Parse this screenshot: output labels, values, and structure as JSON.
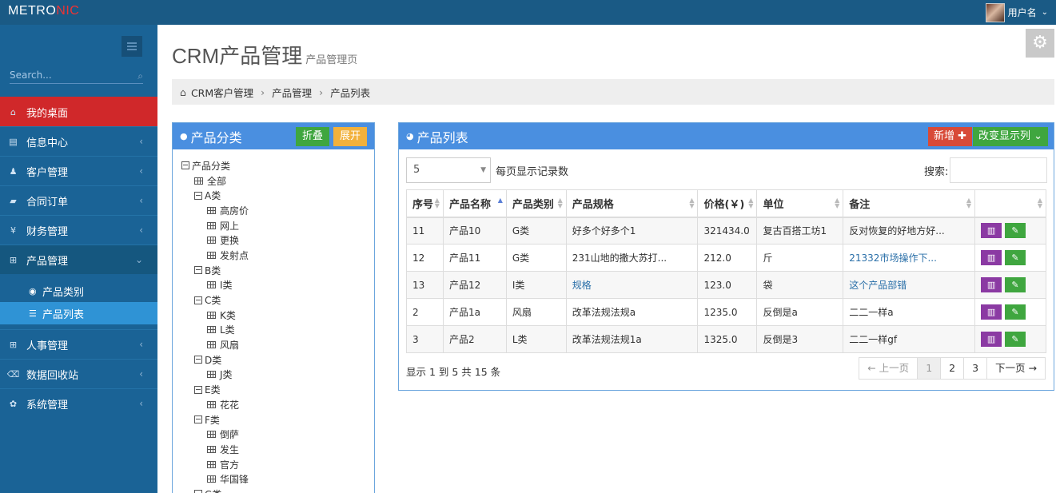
{
  "app": {
    "logo_left": "METRO",
    "logo_accent": "NIC",
    "user_name": "用户名"
  },
  "sidebar": {
    "search_placeholder": "Search...",
    "items": [
      {
        "label": "我的桌面",
        "icon": "home-icon"
      },
      {
        "label": "信息中心",
        "icon": "message-icon"
      },
      {
        "label": "客户管理",
        "icon": "user-icon"
      },
      {
        "label": "合同订单",
        "icon": "book-icon"
      },
      {
        "label": "财务管理",
        "icon": "yen-icon"
      },
      {
        "label": "产品管理",
        "icon": "table-icon"
      },
      {
        "label": "人事管理",
        "icon": "table-icon"
      },
      {
        "label": "数据回收站",
        "icon": "trash-icon"
      },
      {
        "label": "系统管理",
        "icon": "gear-icon"
      }
    ],
    "sub_items": [
      {
        "label": "产品类别"
      },
      {
        "label": "产品列表"
      }
    ]
  },
  "page": {
    "title": "CRM产品管理",
    "subtitle": "产品管理页"
  },
  "breadcrumb": [
    "CRM客户管理",
    "产品管理",
    "产品列表"
  ],
  "category_panel": {
    "title": "产品分类",
    "collapse_label": "折叠",
    "expand_label": "展开",
    "tree": [
      {
        "label": "产品分类",
        "level": 0,
        "type": "folder"
      },
      {
        "label": "全部",
        "level": 1,
        "type": "leaf"
      },
      {
        "label": "A类",
        "level": 1,
        "type": "folder"
      },
      {
        "label": "高房价",
        "level": 2,
        "type": "leaf"
      },
      {
        "label": "网上",
        "level": 2,
        "type": "leaf"
      },
      {
        "label": "更换",
        "level": 2,
        "type": "leaf"
      },
      {
        "label": "发射点",
        "level": 2,
        "type": "leaf"
      },
      {
        "label": "B类",
        "level": 1,
        "type": "folder"
      },
      {
        "label": "I类",
        "level": 2,
        "type": "leaf"
      },
      {
        "label": "C类",
        "level": 1,
        "type": "folder"
      },
      {
        "label": "K类",
        "level": 2,
        "type": "leaf"
      },
      {
        "label": "L类",
        "level": 2,
        "type": "leaf"
      },
      {
        "label": "风扇",
        "level": 2,
        "type": "leaf"
      },
      {
        "label": "D类",
        "level": 1,
        "type": "folder"
      },
      {
        "label": "J类",
        "level": 2,
        "type": "leaf"
      },
      {
        "label": "E类",
        "level": 1,
        "type": "folder"
      },
      {
        "label": "花花",
        "level": 2,
        "type": "leaf"
      },
      {
        "label": "F类",
        "level": 1,
        "type": "folder"
      },
      {
        "label": "倒萨",
        "level": 2,
        "type": "leaf"
      },
      {
        "label": "发生",
        "level": 2,
        "type": "leaf"
      },
      {
        "label": "官方",
        "level": 2,
        "type": "leaf"
      },
      {
        "label": "华国锋",
        "level": 2,
        "type": "leaf"
      },
      {
        "label": "G类",
        "level": 1,
        "type": "folder"
      }
    ]
  },
  "list_panel": {
    "title": "产品列表",
    "add_label": "新增",
    "columns_label": "改变显示列",
    "page_size": "5",
    "page_size_label": "每页显示记录数",
    "search_label": "搜索:",
    "headers": [
      "序号",
      "产品名称",
      "产品类别",
      "产品规格",
      "价格(￥)",
      "单位",
      "备注",
      ""
    ],
    "rows": [
      [
        "11",
        "产品10",
        "G类",
        "好多个好多个1",
        "321434.0",
        "复古百搭工坊1",
        "反对恢复的好地方好..."
      ],
      [
        "12",
        "产品11",
        "G类",
        "231山地的撒大苏打...",
        "212.0",
        "斤",
        "21332市场操作下..."
      ],
      [
        "13",
        "产品12",
        "I类",
        "规格",
        "123.0",
        "袋",
        "这个产品部错"
      ],
      [
        "2",
        "产品1a",
        "风扇",
        "改革法规法规a",
        "1235.0",
        "反倒是a",
        "二二一样a"
      ],
      [
        "3",
        "产品2",
        "L类",
        "改革法规法规1a",
        "1325.0",
        "反倒是3",
        "二二一样gf"
      ]
    ],
    "link_cells": [
      [
        1,
        6
      ],
      [
        2,
        3
      ],
      [
        2,
        6
      ]
    ],
    "info": "显示 1 到 5 共 15 条",
    "pagination": {
      "prev": "← 上一页",
      "pages": [
        "1",
        "2",
        "3"
      ],
      "next": "下一页 →",
      "current": "1"
    }
  },
  "colors": {
    "header": "#1a5a85",
    "sidebar": "#1a6396",
    "active": "#d0282a",
    "panel": "#4a8fe0",
    "submenu_selected": "#2f93d5"
  }
}
